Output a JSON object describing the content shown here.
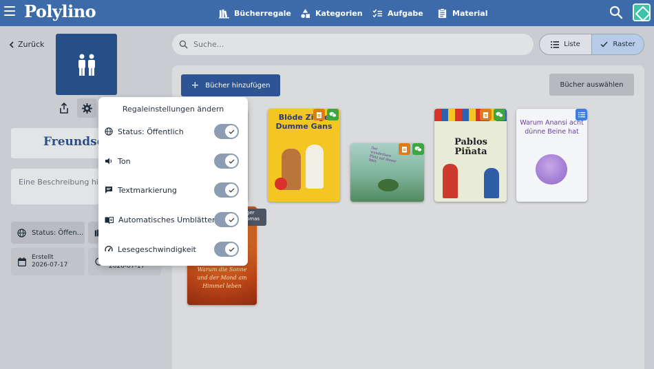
{
  "app": {
    "logo_text": "Polylino",
    "brand_color": "#3d6aa8"
  },
  "nav": [
    {
      "label": "Bücherregale",
      "icon": "bookshelf-icon"
    },
    {
      "label": "Kategorien",
      "icon": "categories-icon"
    },
    {
      "label": "Aufgabe",
      "icon": "checklist-icon"
    },
    {
      "label": "Material",
      "icon": "clipboard-icon"
    }
  ],
  "left": {
    "back_label": "Zurück",
    "shelf_title": "Freundse",
    "description_placeholder": "Eine Beschreibung hin",
    "status_chip": "Status: Öffen...",
    "created_label": "Erstellt",
    "created_date": "2026-07-17",
    "updated_date": "2026-07-17"
  },
  "search": {
    "placeholder": "Suche..."
  },
  "view_toggle": {
    "list_label": "Liste",
    "grid_label": "Raster",
    "selected": "Raster"
  },
  "actions": {
    "add_books": "Bücher hinzufügen",
    "select_books": "Bücher auswählen"
  },
  "books": [
    {
      "title_line1": "Blöde Ziege",
      "title_line2": "Dumme Gans",
      "badges": [
        "clipboard",
        "chat"
      ]
    },
    {
      "title": "Der wunderbare Platz auf dieser Welt",
      "badges": [
        "clipboard",
        "chat"
      ]
    },
    {
      "title": "Pablos Piñata",
      "badges": [
        "clipboard",
        "chat"
      ]
    },
    {
      "title_line1": "Warum Anansi acht",
      "title_line2": "dünne Beine hat",
      "badges": [
        "checklist"
      ]
    },
    {
      "title_line1": "Warum die Sonne",
      "title_line2": "und der Mond am",
      "title_line3": "Himmel leben",
      "badges": []
    }
  ],
  "popup": {
    "title": "Regaleinstellungen ändern",
    "settings": [
      {
        "label": "Status: Öffentlich",
        "icon": "globe-icon",
        "enabled": true
      },
      {
        "label": "Ton",
        "icon": "speaker-icon",
        "enabled": true
      },
      {
        "label": "Textmarkierung",
        "icon": "text-highlight-icon",
        "enabled": true
      },
      {
        "label": "Automatisches Umblättern",
        "icon": "page-turn-icon",
        "enabled": true
      },
      {
        "label": "Lesegeschwindigkeit",
        "icon": "speedometer-icon",
        "enabled": true
      }
    ]
  },
  "tooltip": {
    "line1": "ger",
    "line2": "omas"
  }
}
